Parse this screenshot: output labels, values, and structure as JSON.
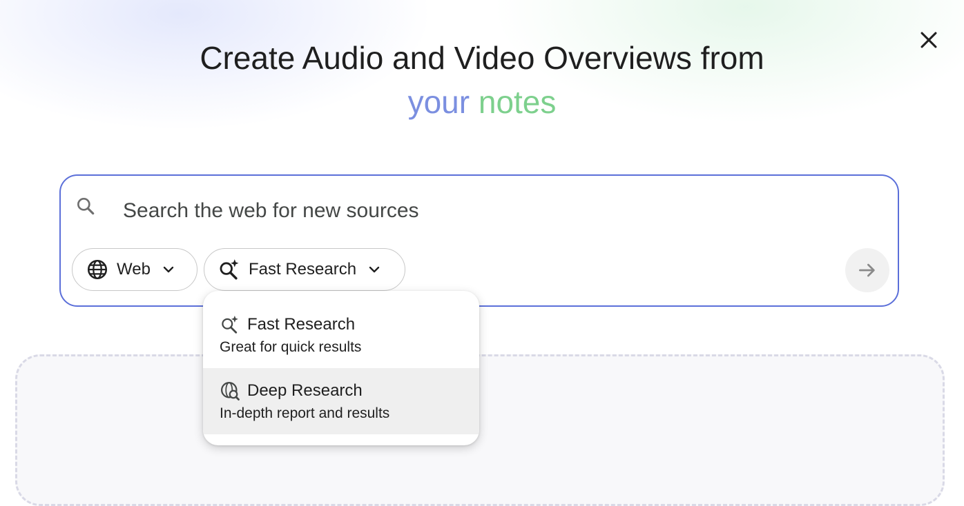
{
  "header": {
    "title_line1": "Create Audio and Video Overviews from",
    "title_word_1": "your",
    "title_word_2": "notes"
  },
  "search": {
    "placeholder": "Search the web for new sources"
  },
  "chips": {
    "source": {
      "label": "Web",
      "icon": "globe-icon"
    },
    "mode": {
      "label": "Fast Research",
      "icon": "sparkle-search-icon"
    }
  },
  "dropdown": {
    "items": [
      {
        "title": "Fast Research",
        "description": "Great for quick results",
        "icon": "sparkle-search-icon"
      },
      {
        "title": "Deep Research",
        "description": "In-depth report and results",
        "icon": "globe-search-icon"
      }
    ]
  },
  "colors": {
    "accent_border": "#5b6fd9",
    "gradient_blue": "#7b8fe0",
    "gradient_green": "#7dd08d"
  },
  "icons": [
    "close-icon",
    "search-icon",
    "globe-icon",
    "chevron-down-icon",
    "sparkle-search-icon",
    "arrow-right-icon",
    "globe-search-icon"
  ]
}
